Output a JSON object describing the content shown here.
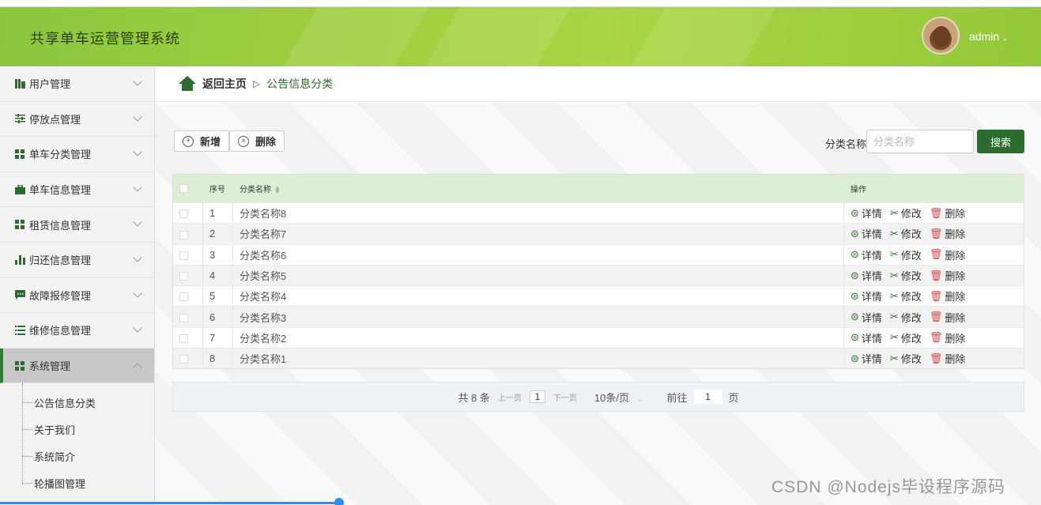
{
  "app": {
    "title": "共享单车运营管理系统"
  },
  "user": {
    "name": "admin",
    "caret": "⌄"
  },
  "sidebar": {
    "items": [
      {
        "label": "用户管理",
        "icon": "bar-icon"
      },
      {
        "label": "停放点管理",
        "icon": "sliders-icon"
      },
      {
        "label": "单车分类管理",
        "icon": "grid-icon"
      },
      {
        "label": "单车信息管理",
        "icon": "briefcase-icon"
      },
      {
        "label": "租赁信息管理",
        "icon": "grid-icon"
      },
      {
        "label": "归还信息管理",
        "icon": "chart-icon"
      },
      {
        "label": "故障报修管理",
        "icon": "chat-icon"
      },
      {
        "label": "维修信息管理",
        "icon": "list-icon"
      },
      {
        "label": "系统管理",
        "icon": "grid-icon"
      }
    ],
    "sub_items": [
      {
        "label": "公告信息分类"
      },
      {
        "label": "关于我们"
      },
      {
        "label": "系统简介"
      },
      {
        "label": "轮播图管理"
      }
    ]
  },
  "breadcrumb": {
    "home": "返回主页",
    "separator": "▷",
    "current": "公告信息分类"
  },
  "toolbar": {
    "add_label": "新增",
    "delete_label": "删除"
  },
  "search": {
    "label": "分类名称",
    "placeholder": "分类名称",
    "button": "搜索"
  },
  "table": {
    "columns": {
      "index": "序号",
      "name": "分类名称",
      "ops": "操作"
    },
    "op_labels": {
      "detail": "详情",
      "edit": "修改",
      "delete": "删除"
    },
    "rows": [
      {
        "index": "1",
        "name": "分类名称8"
      },
      {
        "index": "2",
        "name": "分类名称7"
      },
      {
        "index": "3",
        "name": "分类名称6"
      },
      {
        "index": "4",
        "name": "分类名称5"
      },
      {
        "index": "5",
        "name": "分类名称4"
      },
      {
        "index": "6",
        "name": "分类名称3"
      },
      {
        "index": "7",
        "name": "分类名称2"
      },
      {
        "index": "8",
        "name": "分类名称1"
      }
    ]
  },
  "pager": {
    "total": "共 8 条",
    "prev": "上一页",
    "current": "1",
    "next": "下一页",
    "page_size": "10条/页",
    "goto_label": "前往",
    "goto_value": "1",
    "goto_suffix": "页"
  },
  "watermark": "CSDN @Nodejs毕设程序源码",
  "colors": {
    "primary": "#2e6b2e",
    "header": "#9fd03f",
    "table_header": "#dcefd5",
    "delete": "#e04848"
  }
}
